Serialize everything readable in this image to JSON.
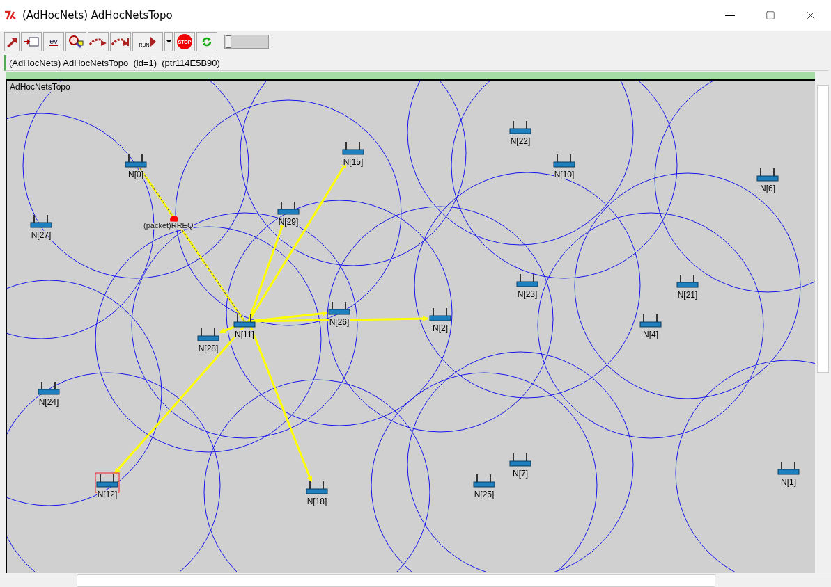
{
  "window": {
    "title": "(AdHocNets) AdHocNetsTopo"
  },
  "toolbar": {
    "buttons": [
      {
        "kind": "step"
      },
      {
        "kind": "inspect"
      },
      {
        "kind": "events",
        "label": "ev"
      },
      {
        "kind": "find"
      },
      {
        "kind": "fast"
      },
      {
        "kind": "express"
      },
      {
        "kind": "run",
        "label": "RUN"
      },
      {
        "kind": "dropdown"
      },
      {
        "kind": "stop",
        "label": "STOP"
      },
      {
        "kind": "refresh"
      }
    ],
    "speed": {
      "level": 0.02
    }
  },
  "info_bar": {
    "text": "(AdHocNets) AdHocNetsTopo  (id=1)  (ptr114E5B90)"
  },
  "canvas": {
    "title": "AdHocNetsTopo",
    "nodes": [
      {
        "label": "N[0]",
        "selected": false
      },
      {
        "label": "N[15]",
        "selected": false
      },
      {
        "label": "N[22]",
        "selected": false
      },
      {
        "label": "N[10]",
        "selected": false
      },
      {
        "label": "N[6]",
        "selected": false
      },
      {
        "label": "N[27]",
        "selected": false
      },
      {
        "label": "N[29]",
        "selected": false
      },
      {
        "label": "N[23]",
        "selected": false
      },
      {
        "label": "N[21]",
        "selected": false
      },
      {
        "label": "N[26]",
        "selected": false
      },
      {
        "label": "N[11]",
        "selected": false
      },
      {
        "label": "N[2]",
        "selected": false
      },
      {
        "label": "N[4]",
        "selected": false
      },
      {
        "label": "N[28]",
        "selected": false
      },
      {
        "label": "N[24]",
        "selected": false
      },
      {
        "label": "N[12]",
        "selected": true
      },
      {
        "label": "N[7]",
        "selected": false
      },
      {
        "label": "N[25]",
        "selected": false
      },
      {
        "label": "N[18]",
        "selected": false
      },
      {
        "label": "N[1]",
        "selected": false
      }
    ],
    "message": {
      "label": "(packet)RREQ"
    }
  }
}
